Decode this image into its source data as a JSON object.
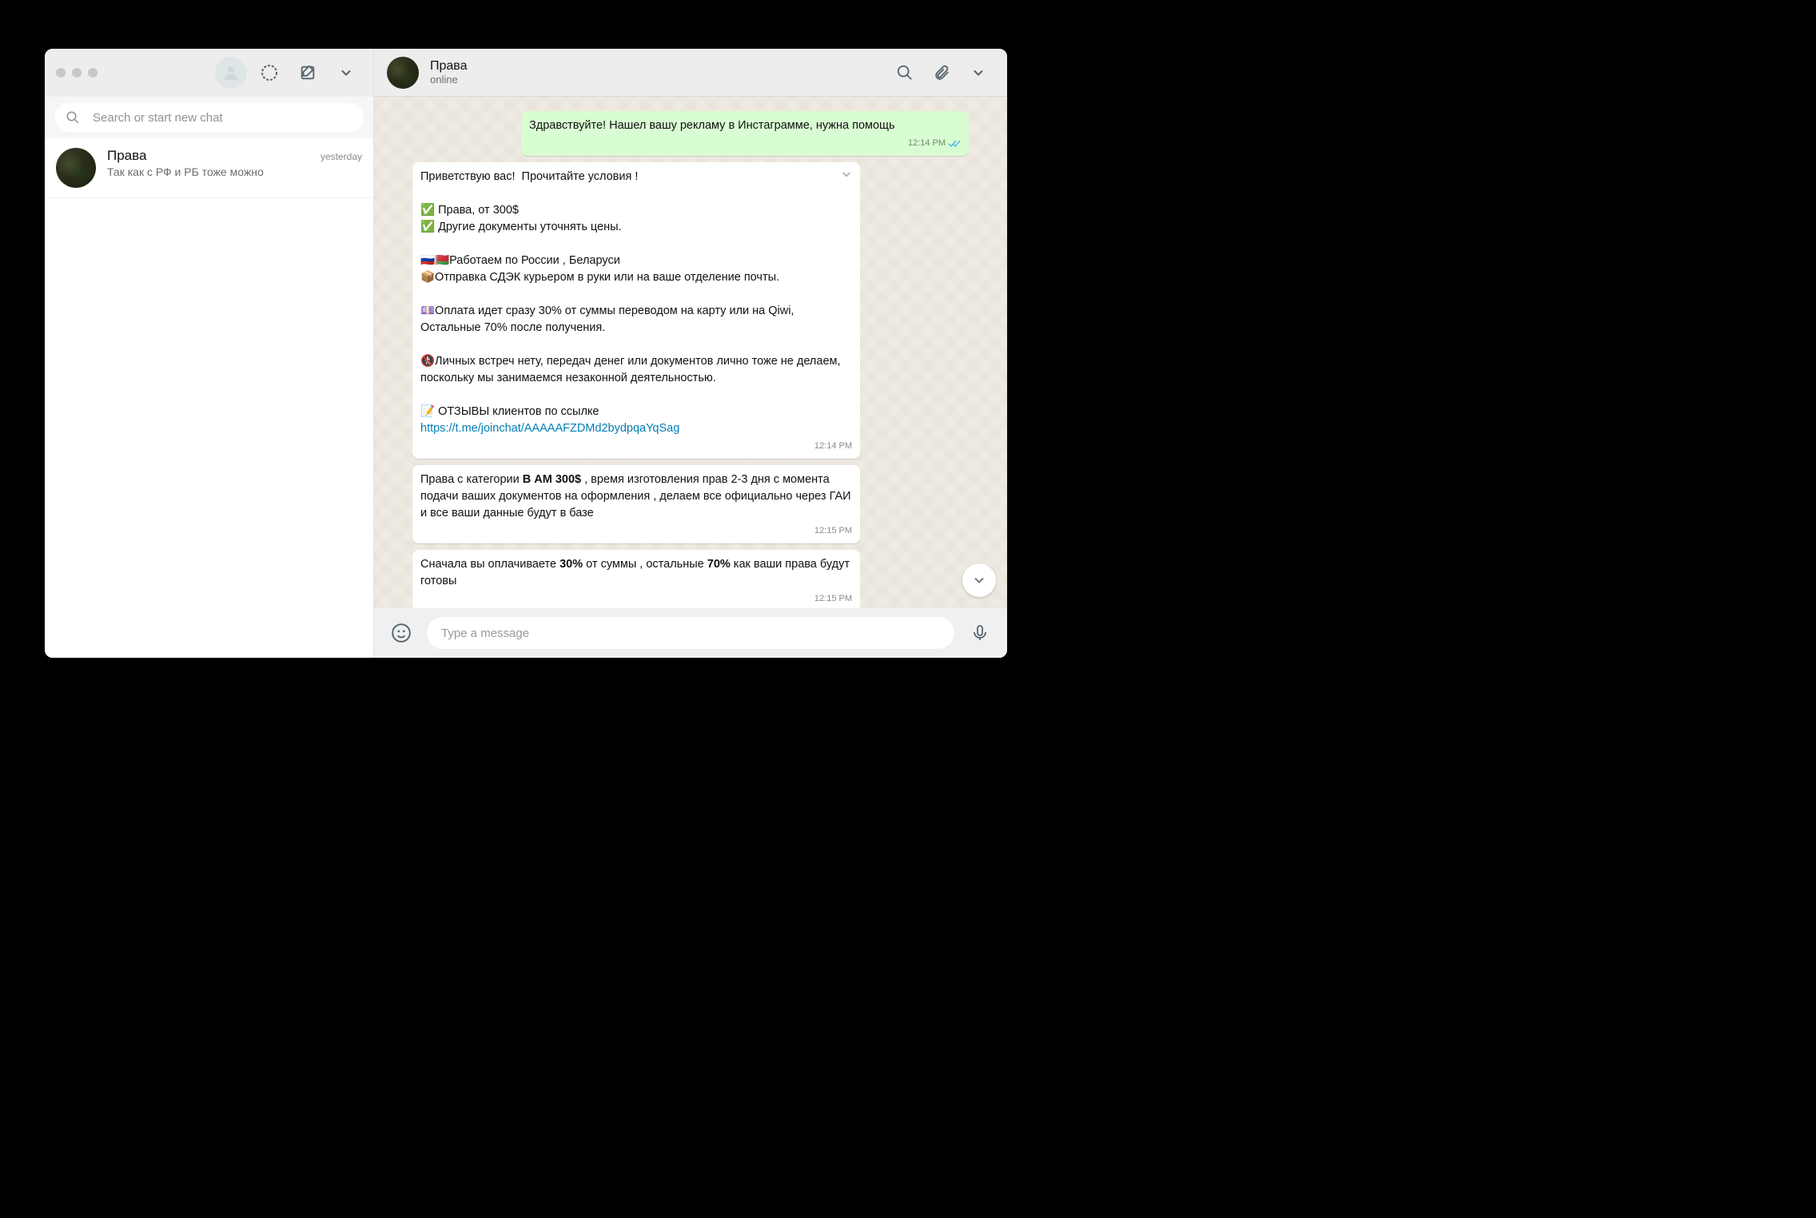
{
  "sidebar": {
    "search_placeholder": "Search or start new chat"
  },
  "chats": [
    {
      "name": "Права",
      "preview": "Так как с РФ и РБ тоже можно",
      "time": "yesterday"
    }
  ],
  "header": {
    "name": "Права",
    "status": "online"
  },
  "composer": {
    "placeholder": "Type a message"
  },
  "messages": {
    "m0": {
      "text": "Здравствуйте! Нашел вашу рекламу в Инстаграмме, нужна помощь",
      "time": "12:14 PM"
    },
    "m1": {
      "text_part1": "Приветствую вас!  Прочитайте условия !\n\n✅ Права, от 300$\n✅ Другие документы уточнять цены.\n\n🇷🇺🇧🇾Работаем по России , Беларуси\n📦Отправка СДЭК курьером в руки или на ваше отделение почты.\n\n💷Оплата идет сразу 30% от суммы переводом на карту или на Qiwi, Остальные 70% после получения.\n\n🚷Личных встреч нету, передач денег или документов лично тоже не делаем, поскольку мы занимаемся незаконной деятельностью.\n\n📝 ОТЗЫВЫ клиентов по ссылке",
      "link": "https://t.me/joinchat/AAAAAFZDMd2bydpqaYqSag",
      "time": "12:14 PM"
    },
    "m2": {
      "seg1": "Права с категории ",
      "bold1": "В АМ 300$",
      "seg2": " , время изготовления прав 2-3 дня с момента подачи ваших документов на оформления , делаем все официально через ГАИ и все ваши данные будут в базе",
      "time": "12:15 PM"
    },
    "m3": {
      "seg1": "Сначала вы оплачиваете ",
      "bold1": "30%",
      "seg2": " от суммы , остальные ",
      "bold2": "70%",
      "seg3": " как ваши права будут готовы",
      "time": "12:15 PM"
    }
  }
}
